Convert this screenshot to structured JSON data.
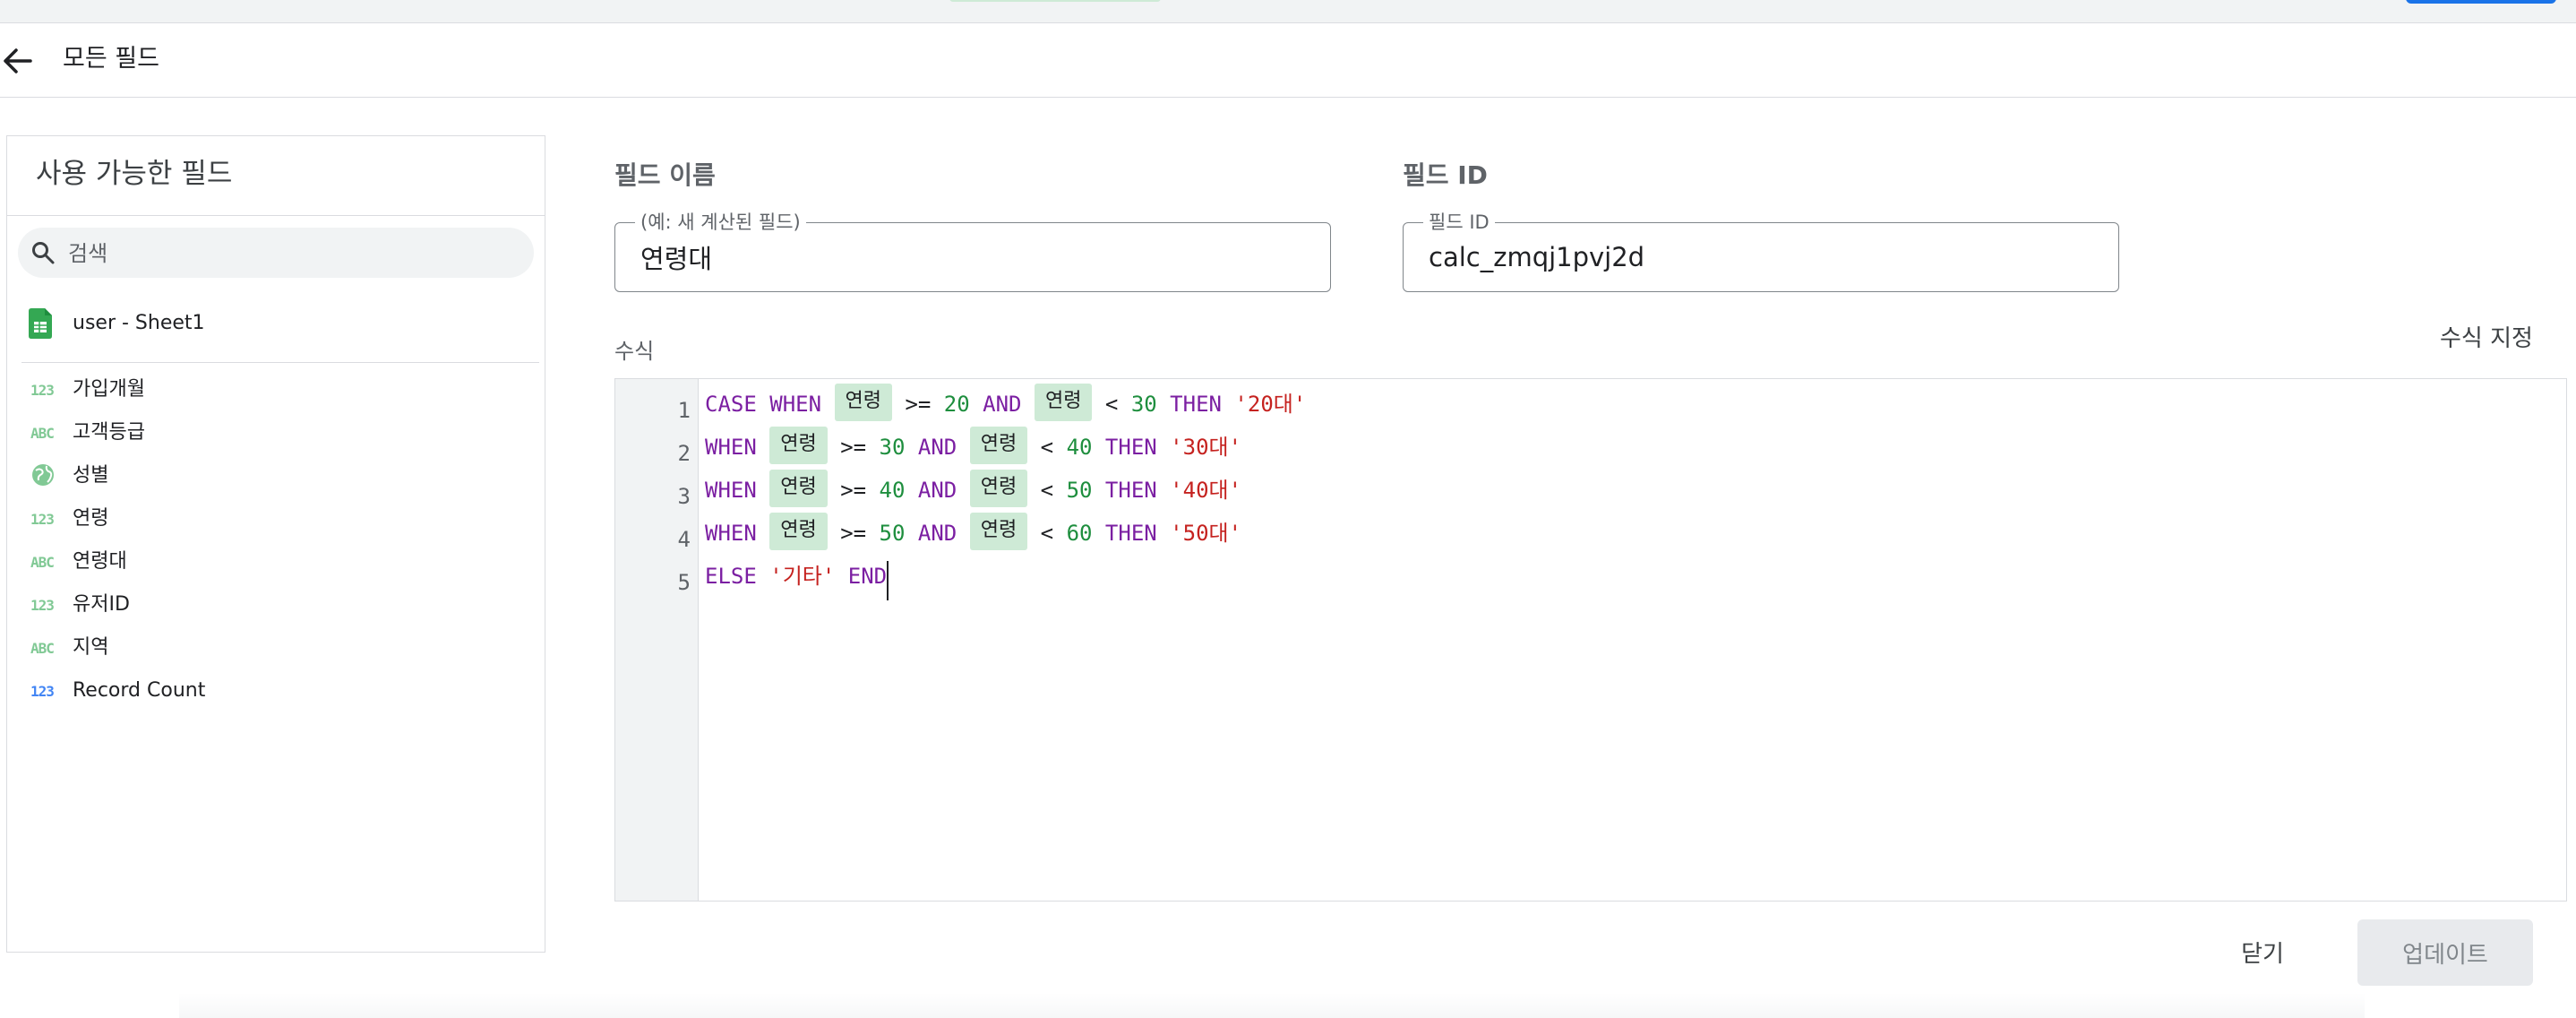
{
  "header": {
    "title": "모든 필드"
  },
  "left_panel": {
    "title": "사용 가능한 필드",
    "search_placeholder": "검색",
    "data_source": "user - Sheet1",
    "fields": [
      {
        "type_badge": "123",
        "label": "가입개월",
        "icon": "number-type-icon"
      },
      {
        "type_badge": "ABC",
        "label": "고객등급",
        "icon": "text-type-icon"
      },
      {
        "type_badge": "",
        "label": "성별",
        "icon": "globe-icon"
      },
      {
        "type_badge": "123",
        "label": "연령",
        "icon": "number-type-icon"
      },
      {
        "type_badge": "ABC",
        "label": "연령대",
        "icon": "text-type-icon"
      },
      {
        "type_badge": "123",
        "label": "유저ID",
        "icon": "number-type-icon"
      },
      {
        "type_badge": "ABC",
        "label": "지역",
        "icon": "text-type-icon"
      },
      {
        "type_badge": "123",
        "label": "Record Count",
        "icon": "number-type-icon"
      }
    ]
  },
  "form": {
    "field_name_label": "필드 이름",
    "field_name_legend": "(예: 새 계산된 필드)",
    "field_name_value": "연령대",
    "field_id_label": "필드 ID",
    "field_id_legend": "필드 ID",
    "field_id_value": "calc_zmqj1pvj2d",
    "formula_label": "수식",
    "format_formula": "수식 지정"
  },
  "editor": {
    "line_numbers": [
      "1",
      "2",
      "3",
      "4",
      "5"
    ],
    "lines": [
      {
        "kw1": "CASE WHEN",
        "chip1": "연령",
        "op1": ">=",
        "n1": "20",
        "and": "AND",
        "chip2": "연령",
        "op2": "<",
        "n2": "30",
        "then": "THEN",
        "str": "'20대'"
      },
      {
        "kw1": "WHEN",
        "chip1": "연령",
        "op1": ">=",
        "n1": "30",
        "and": "AND",
        "chip2": "연령",
        "op2": "<",
        "n2": "40",
        "then": "THEN",
        "str": "'30대'"
      },
      {
        "kw1": "WHEN",
        "chip1": "연령",
        "op1": ">=",
        "n1": "40",
        "and": "AND",
        "chip2": "연령",
        "op2": "<",
        "n2": "50",
        "then": "THEN",
        "str": "'40대'"
      },
      {
        "kw1": "WHEN",
        "chip1": "연령",
        "op1": ">=",
        "n1": "50",
        "and": "AND",
        "chip2": "연령",
        "op2": "<",
        "n2": "60",
        "then": "THEN",
        "str": "'50대'"
      }
    ],
    "last_line": {
      "else": "ELSE",
      "str": "'기타'",
      "end": "END"
    }
  },
  "actions": {
    "close": "닫기",
    "update": "업데이트"
  },
  "colors": {
    "keyword": "#7b1fa2",
    "number": "#1e8e3e",
    "string": "#c5221f",
    "chip": "#ceead6",
    "accent": "#1a73e8"
  }
}
